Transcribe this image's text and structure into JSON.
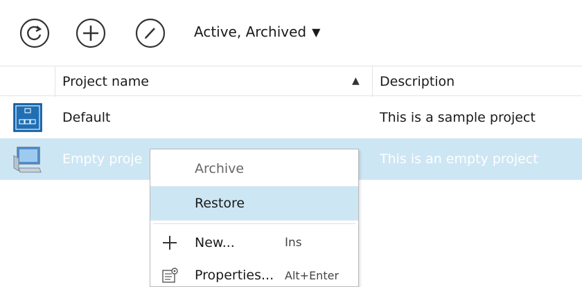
{
  "toolbar": {
    "filter_label": "Active, Archived",
    "icons": [
      "refresh-icon",
      "add-icon",
      "edit-icon",
      "caret-down-icon"
    ]
  },
  "grid": {
    "columns": {
      "name": "Project name",
      "description": "Description"
    },
    "rows": [
      {
        "name": "Default",
        "description": "This is a sample project",
        "icon": "default-project-icon",
        "selected": false
      },
      {
        "name": "Empty proje",
        "description": "This is an empty project",
        "icon": "empty-project-icon",
        "selected": true
      }
    ]
  },
  "context_menu": {
    "archive": "Archive",
    "restore": "Restore",
    "new": "New...",
    "new_shortcut": "Ins",
    "properties": "Properties...",
    "properties_shortcut": "Alt+Enter"
  },
  "colors": {
    "selection": "#cce6f4",
    "project_icon_blue": "#1f6fb5"
  }
}
